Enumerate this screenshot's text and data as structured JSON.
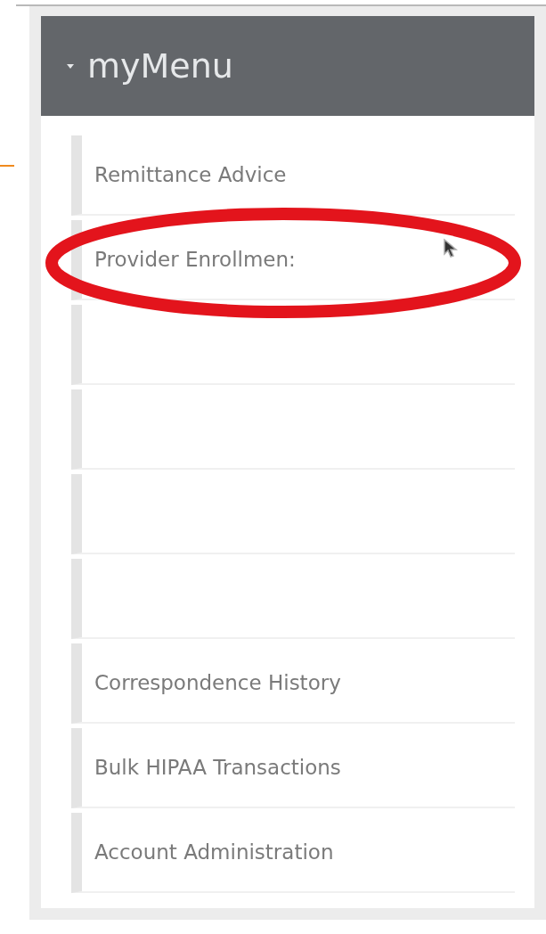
{
  "menu": {
    "title": "myMenu",
    "expanded": true,
    "items": [
      {
        "kind": "link",
        "label": "Remittance Advice"
      },
      {
        "kind": "link",
        "label": "Provider Enrollmen:"
      },
      {
        "kind": "blank"
      },
      {
        "kind": "blank"
      },
      {
        "kind": "blank"
      },
      {
        "kind": "blank"
      },
      {
        "kind": "link",
        "label": "Correspondence History"
      },
      {
        "kind": "link",
        "label": "Bulk HIPAA Transactions"
      },
      {
        "kind": "link",
        "label": "Account Administration"
      }
    ]
  }
}
